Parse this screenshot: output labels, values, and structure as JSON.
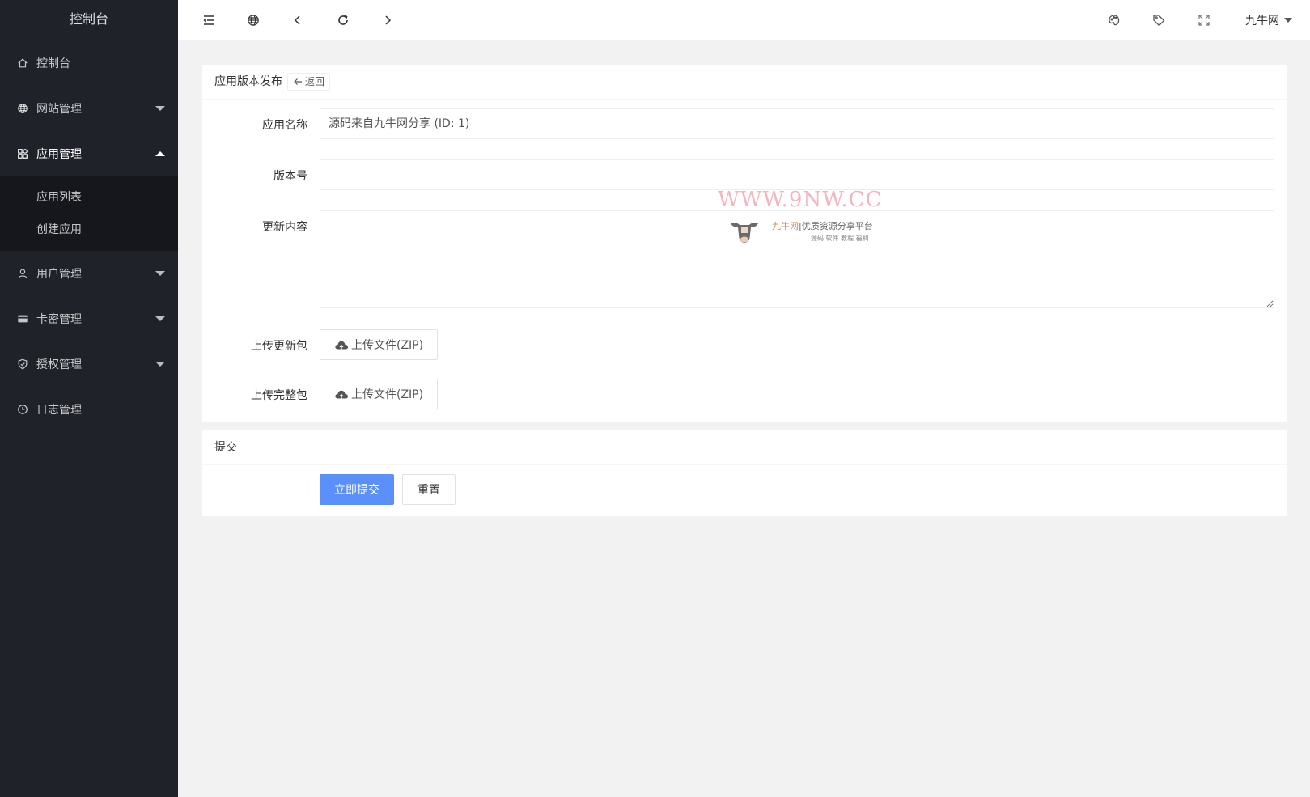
{
  "sidebar": {
    "logo": "控制台",
    "items": [
      {
        "label": "控制台"
      },
      {
        "label": "网站管理"
      },
      {
        "label": "应用管理"
      },
      {
        "label": "用户管理"
      },
      {
        "label": "卡密管理"
      },
      {
        "label": "授权管理"
      },
      {
        "label": "日志管理"
      }
    ],
    "submenu": [
      {
        "label": "应用列表"
      },
      {
        "label": "创建应用"
      }
    ]
  },
  "header": {
    "user": "九牛网",
    "icons": [
      "menu-fold-icon",
      "globe-icon",
      "chevron-left-icon",
      "refresh-icon",
      "chevron-right-icon",
      "palette-icon",
      "tag-icon",
      "fullscreen-icon"
    ]
  },
  "form_card": {
    "title": "应用版本发布",
    "back_label": "返回",
    "fields": {
      "app_name": {
        "label": "应用名称",
        "value": "源码来自九牛网分享 (ID: 1)"
      },
      "version": {
        "label": "版本号",
        "value": ""
      },
      "changelog": {
        "label": "更新内容",
        "value": ""
      },
      "update_pkg": {
        "label": "上传更新包",
        "button": "上传文件(ZIP)"
      },
      "full_pkg": {
        "label": "上传完整包",
        "button": "上传文件(ZIP)"
      }
    }
  },
  "submit_card": {
    "title": "提交",
    "submit_label": "立即提交",
    "reset_label": "重置"
  },
  "watermark": {
    "url": "WWW.9NW.CC",
    "brand": "九牛网",
    "slogan": "优质资源分享平台",
    "tags": "源码  软件  教程  福利"
  },
  "colors": {
    "sidebar_bg": "#20222a",
    "primary": "#5b8ff9",
    "page_bg": "#f2f2f2"
  }
}
